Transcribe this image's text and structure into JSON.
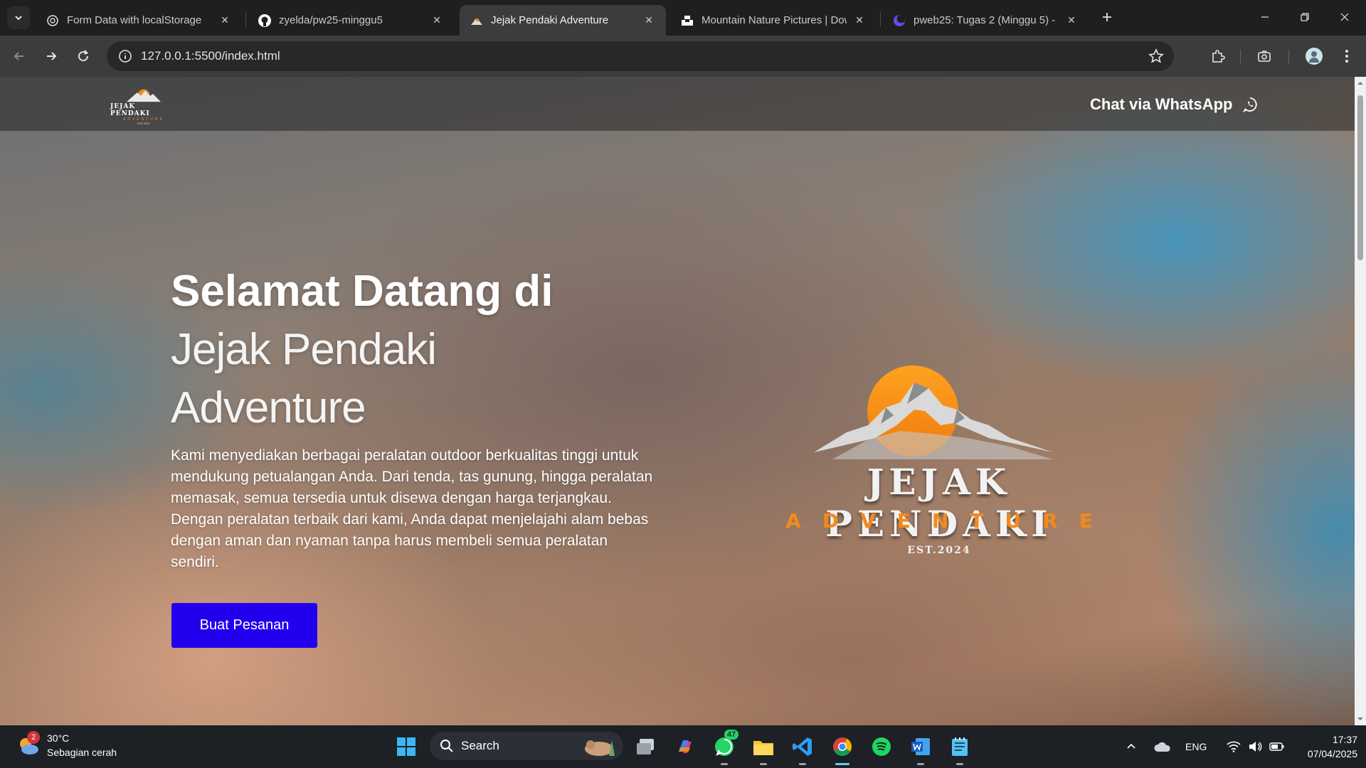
{
  "browser": {
    "tabs": [
      {
        "title": "Form Data with localStorage",
        "icon": "globe-icon",
        "active": false
      },
      {
        "title": "zyelda/pw25-minggu5",
        "icon": "github-icon",
        "active": false
      },
      {
        "title": "Jejak Pendaki Adventure",
        "icon": "mountain-favicon",
        "active": true
      },
      {
        "title": "Mountain Nature Pictures | Dow",
        "icon": "unsplash-icon",
        "active": false
      },
      {
        "title": "pweb25: Tugas 2 (Minggu 5) - I",
        "icon": "moodle-icon",
        "active": false
      }
    ],
    "url": "127.0.0.1:5500/index.html"
  },
  "site": {
    "logo": {
      "line1": "JEJAK PENDAKI",
      "line2": "ADVENTURE",
      "line3": "EST.2024"
    },
    "whatsapp_label": "Chat via WhatsApp",
    "hero": {
      "title": "Selamat Datang di",
      "subtitle_line1": "Jejak Pendaki",
      "subtitle_line2": "Adventure",
      "description": "Kami menyediakan berbagai peralatan outdoor berkualitas tinggi untuk mendukung petualangan Anda. Dari tenda, tas gunung, hingga peralatan memasak, semua tersedia untuk disewa dengan harga terjangkau. Dengan peralatan terbaik dari kami, Anda dapat menjelajahi alam bebas dengan aman dan nyaman tanpa harus membeli semua peralatan sendiri.",
      "cta_label": "Buat Pesanan"
    },
    "big_logo": {
      "name": "JEJAK PENDAKI",
      "tagline": "ADVENTURE",
      "est": "EST.2024"
    },
    "colors": {
      "accent_orange": "#f28a1c",
      "cta_blue": "#2200ee"
    }
  },
  "taskbar": {
    "weather": {
      "temp": "30°C",
      "desc": "Sebagian cerah",
      "badge": "2"
    },
    "search_placeholder": "Search",
    "whatsapp_badge": "47",
    "language": "ENG",
    "time": "17:37",
    "date": "07/04/2025"
  }
}
